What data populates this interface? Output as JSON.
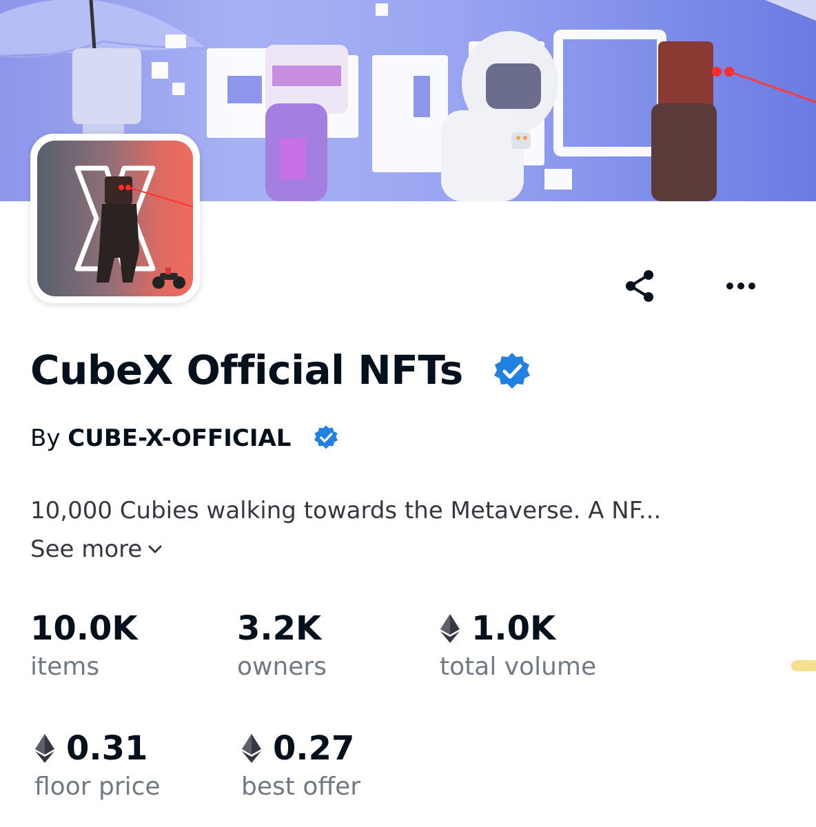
{
  "banner": {
    "logo_text": "CUBEX"
  },
  "collection": {
    "title": "CubeX Official NFTs",
    "by_prefix": "By",
    "creator": "CUBE-X-OFFICIAL",
    "description": "10,000 Cubies walking towards the Metaverse. A NF...",
    "see_more": "See more"
  },
  "stats": [
    {
      "value": "10.0K",
      "label": "items",
      "eth": false
    },
    {
      "value": "3.2K",
      "label": "owners",
      "eth": false
    },
    {
      "value": "1.0K",
      "label": "total volume",
      "eth": true
    },
    {
      "value": "0.31",
      "label": "floor price",
      "eth": true
    },
    {
      "value": "0.27",
      "label": "best offer",
      "eth": true
    }
  ],
  "icons": {
    "share": "share-icon",
    "more": "more-icon",
    "verified": "verified-badge-icon",
    "eth": "ethereum-icon",
    "chevron": "chevron-down-icon"
  },
  "colors": {
    "verified_blue": "#2081e2",
    "text_primary": "#04111d",
    "text_secondary": "#707a83"
  }
}
